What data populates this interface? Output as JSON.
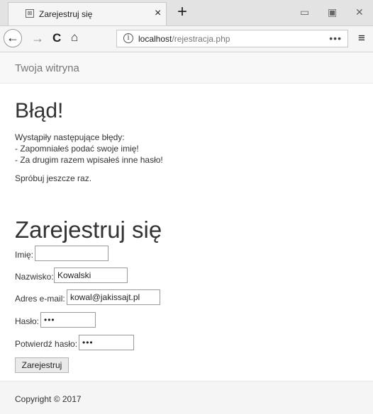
{
  "browser": {
    "tab_title": "Zarejestruj się",
    "tab_close": "×",
    "new_tab": "+",
    "url_host": "localhost",
    "url_path": "/rejestracja.php",
    "url_more": "•••",
    "icons": {
      "back": "←",
      "forward": "→",
      "reload": "C",
      "home": "⌂",
      "info": "i",
      "menu": "≡",
      "minimize": "▭",
      "maximize": "▣",
      "close": "✕"
    }
  },
  "site": {
    "title": "Twoja witryna"
  },
  "error": {
    "title": "Błąd!",
    "intro": "Wystąpiły następujące błędy:",
    "items": [
      "- Zapomniałeś podać swoje imię!",
      "- Za drugim razem wpisałeś inne hasło!"
    ],
    "retry": "Spróbuj jeszcze raz."
  },
  "form": {
    "title": "Zarejestruj się",
    "fields": {
      "first_name": {
        "label": "Imię:",
        "value": ""
      },
      "last_name": {
        "label": "Nazwisko:",
        "value": "Kowalski"
      },
      "email": {
        "label": "Adres e-mail:",
        "value": "kowal@jakissajt.pl"
      },
      "password": {
        "label": "Hasło:",
        "value": "•••"
      },
      "password_confirm": {
        "label": "Potwierdź hasło:",
        "value": "•••"
      }
    },
    "submit_label": "Zarejestruj"
  },
  "footer": {
    "text": "Copyright © 2017"
  }
}
